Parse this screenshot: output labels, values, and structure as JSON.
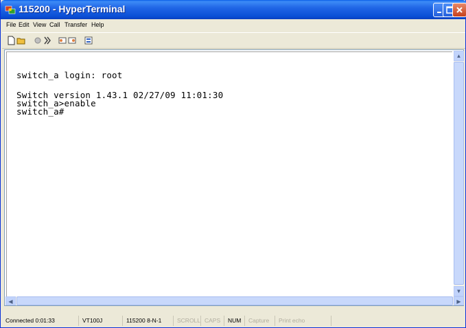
{
  "window": {
    "title": "115200 - HyperTerminal",
    "accent_color": "#0a4fd6",
    "icon": "hyperterminal-app-icon"
  },
  "menu": {
    "items": [
      {
        "label": "File"
      },
      {
        "label": "Edit"
      },
      {
        "label": "View"
      },
      {
        "label": "Call"
      },
      {
        "label": "Transfer"
      },
      {
        "label": "Help"
      }
    ]
  },
  "toolbar": {
    "icons": [
      "new-connection-icon",
      "open-icon",
      "disconnect-icon",
      "call-icon",
      "send-icon",
      "receive-icon",
      "properties-icon"
    ]
  },
  "terminal": {
    "lines": [
      "switch_a login: root",
      "",
      "Switch version 1.43.1 02/27/09 11:01:30",
      "switch_a>enable",
      "switch_a#"
    ]
  },
  "status": {
    "connected": "Connected 0:01:33",
    "emulation": "VT100J",
    "settings": "115200 8-N-1",
    "scroll": "SCROLL",
    "caps": "CAPS",
    "num": "NUM",
    "capture": "Capture",
    "print_echo": "Print echo"
  }
}
